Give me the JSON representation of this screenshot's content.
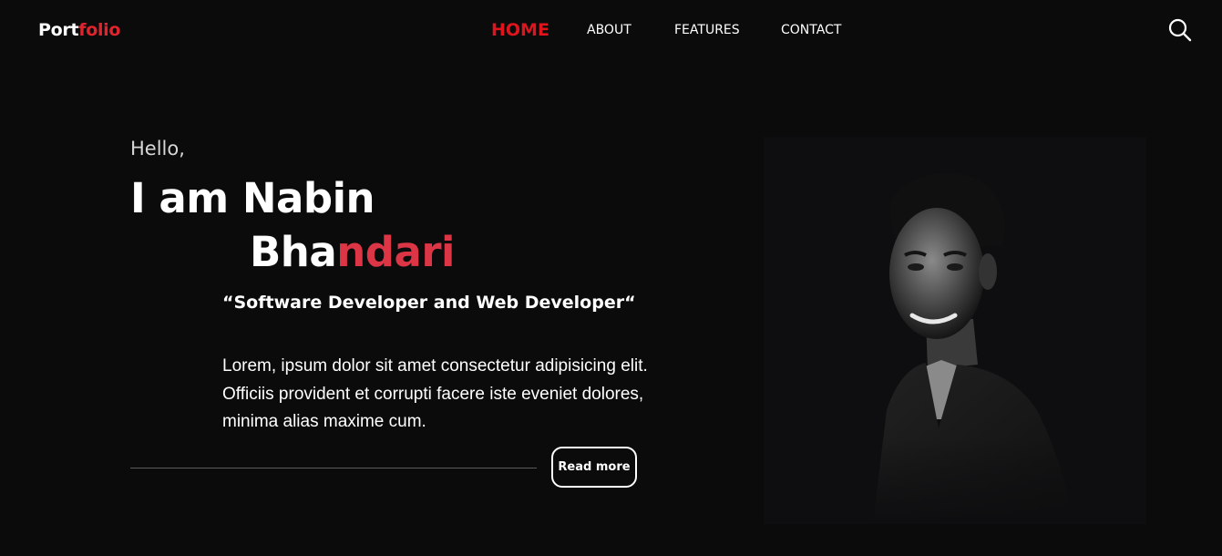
{
  "header": {
    "logo_part1": "Port",
    "logo_part2": "folio",
    "nav": [
      {
        "label": "HOME"
      },
      {
        "label": "ABOUT"
      },
      {
        "label": "FEATURES"
      },
      {
        "label": "CONTACT"
      }
    ],
    "search_icon": "search-icon"
  },
  "hero": {
    "greeting": "Hello,",
    "name_line1": "I am Nabin",
    "name_line2_white": "Bha",
    "name_line2_red": "ndari",
    "tagline": "“Software Developer and Web Developer“",
    "description": "Lorem, ipsum dolor sit amet consectetur adipisicing elit. Officiis provident et corrupti facere iste eveniet dolores, minima alias maxime cum.",
    "button_label": "Read more"
  },
  "colors": {
    "background": "#0b0b0c",
    "accent": "#e0141c",
    "name_accent": "#dc3545",
    "text": "#ffffff"
  }
}
